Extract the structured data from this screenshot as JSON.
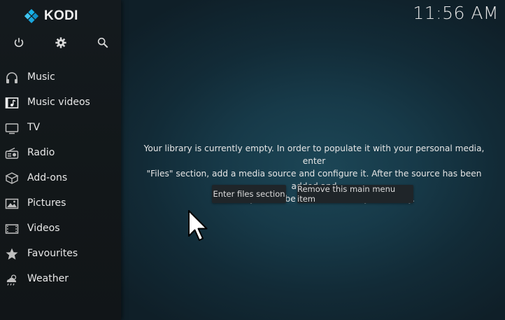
{
  "app": {
    "logo_text": "KODI"
  },
  "clock": {
    "time": "11:56 AM"
  },
  "top_icons": [
    "power-icon",
    "gear-icon",
    "search-icon"
  ],
  "menu": {
    "items": [
      {
        "label": "Music",
        "icon": "headphones-icon"
      },
      {
        "label": "Music videos",
        "icon": "music-video-icon"
      },
      {
        "label": "TV",
        "icon": "tv-icon"
      },
      {
        "label": "Radio",
        "icon": "radio-icon"
      },
      {
        "label": "Add-ons",
        "icon": "addons-box-icon"
      },
      {
        "label": "Pictures",
        "icon": "picture-icon"
      },
      {
        "label": "Videos",
        "icon": "film-icon"
      },
      {
        "label": "Favourites",
        "icon": "star-icon"
      },
      {
        "label": "Weather",
        "icon": "weather-icon"
      }
    ]
  },
  "library": {
    "message_line1": "Your library is currently empty. In order to populate it with your personal media, enter",
    "message_line2": "\"Files\" section, add a media source and configure it. After the source has been added and",
    "message_line3": "indexed you will be able to browse your library.",
    "enter_files_label": "Enter files section",
    "remove_item_label": "Remove this main menu item"
  },
  "colors": {
    "sidebar_bg": "#141a1e",
    "main_bg_center": "#1c4656",
    "logo_blue": "#17b2e8",
    "button_bg": "#1f2529"
  }
}
